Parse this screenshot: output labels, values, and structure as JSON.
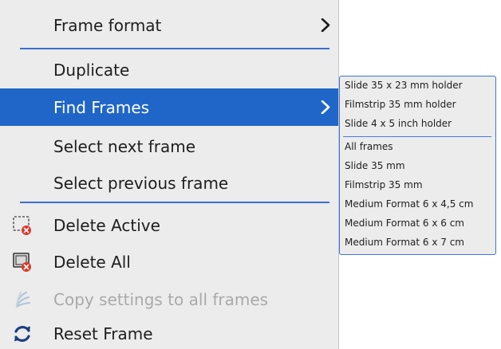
{
  "menu": {
    "items": [
      {
        "label": "Frame format",
        "icon": null,
        "submenu": true,
        "state": "normal"
      },
      {
        "label": "Duplicate",
        "icon": null,
        "submenu": false,
        "state": "normal"
      },
      {
        "label": "Find Frames",
        "icon": null,
        "submenu": true,
        "state": "highlighted"
      },
      {
        "label": "Select next frame",
        "icon": null,
        "submenu": false,
        "state": "normal"
      },
      {
        "label": "Select previous frame",
        "icon": null,
        "submenu": false,
        "state": "normal"
      },
      {
        "label": "Delete Active",
        "icon": "delete-active-icon",
        "submenu": false,
        "state": "normal"
      },
      {
        "label": "Delete All",
        "icon": "delete-all-icon",
        "submenu": false,
        "state": "normal"
      },
      {
        "label": "Copy settings to all frames",
        "icon": "copy-settings-icon",
        "submenu": false,
        "state": "disabled"
      },
      {
        "label": "Reset Frame",
        "icon": "reset-icon",
        "submenu": false,
        "state": "normal"
      }
    ]
  },
  "submenu": {
    "holders": [
      "Slide 35 x 23 mm holder",
      "Filmstrip 35 mm holder",
      "Slide 4 x 5 inch holder"
    ],
    "formats": [
      "All frames",
      "Slide 35 mm",
      "Filmstrip 35 mm",
      "Medium Format 6 x 4,5 cm",
      "Medium Format 6 x 6 cm",
      "Medium Format 6 x 7 cm"
    ]
  },
  "colors": {
    "highlight": "#1f66c8",
    "separator": "#3a6fd0",
    "menu_bg": "#ececec",
    "text": "#1e1e1e",
    "disabled_text": "#a9a9a9",
    "delete_badge": "#d93a2b"
  }
}
